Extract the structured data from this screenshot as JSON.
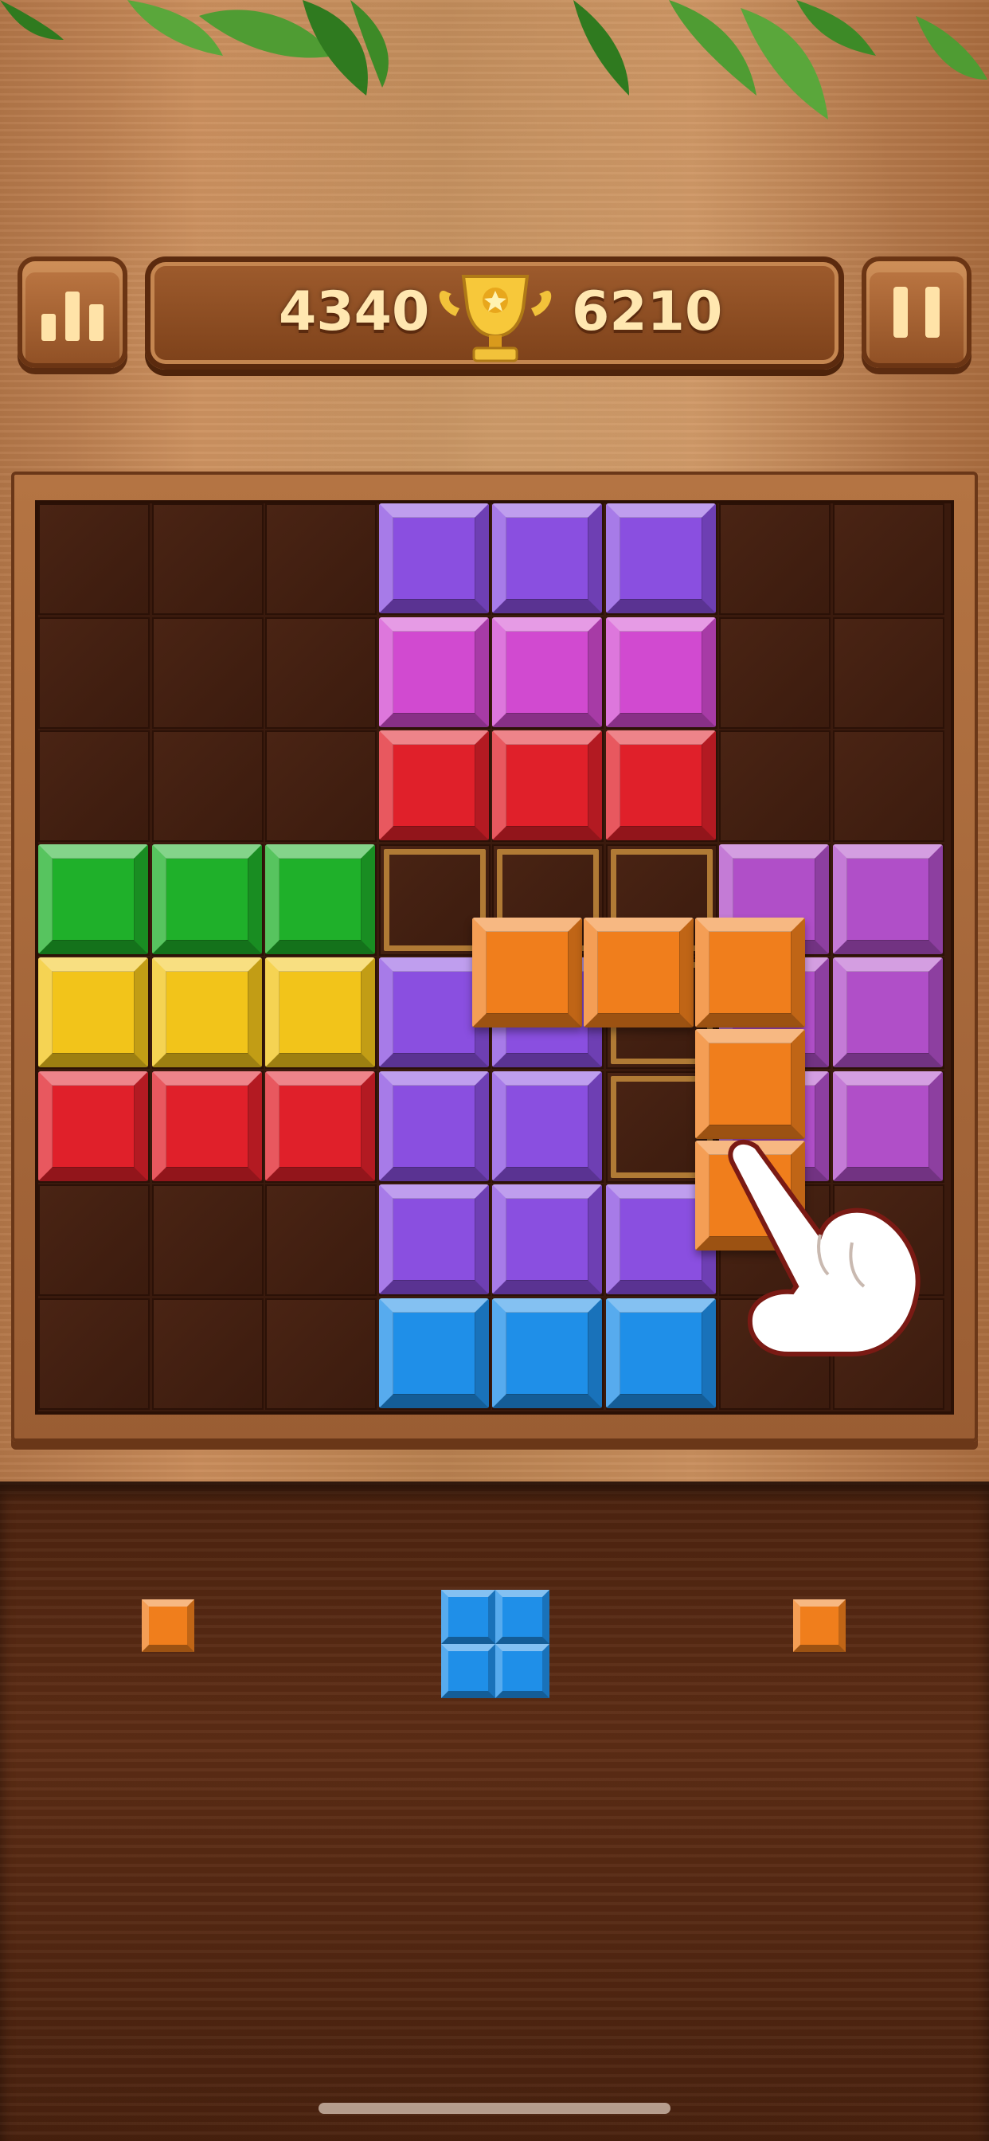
{
  "hud": {
    "current_score": "4340",
    "best_score": "6210",
    "stats_button_icon": "bar-chart-icon",
    "pause_button_icon": "pause-icon",
    "trophy_icon": "trophy-icon"
  },
  "colors": {
    "purple": "#8a4fe0",
    "magenta": "#d14ad0",
    "red": "#e0202a",
    "green": "#1fb02a",
    "yellow": "#f2c41a",
    "blue": "#1f8fe8",
    "orange": "#f07e1c",
    "violet": "#b04fc8"
  },
  "board": {
    "size": 8,
    "grid": [
      [
        null,
        null,
        null,
        "purple",
        "purple",
        "purple",
        null,
        null
      ],
      [
        null,
        null,
        null,
        "magenta",
        "magenta",
        "magenta",
        null,
        null
      ],
      [
        null,
        null,
        null,
        "red",
        "red",
        "red",
        null,
        null
      ],
      [
        "green",
        "green",
        "green",
        "ghost",
        "ghost",
        "ghost",
        "violet",
        "violet"
      ],
      [
        "yellow",
        "yellow",
        "yellow",
        "purple",
        "purple",
        "ghost",
        "violet",
        "violet"
      ],
      [
        "red",
        "red",
        "red",
        "purple",
        "purple",
        "ghost",
        "violet",
        "violet"
      ],
      [
        null,
        null,
        null,
        "purple",
        "purple",
        "purple",
        null,
        null
      ],
      [
        null,
        null,
        null,
        "blue",
        "blue",
        "blue",
        null,
        null
      ]
    ]
  },
  "dragged_piece": {
    "color": "orange",
    "shape": "J-pentomino",
    "icon": "pointing-hand-icon"
  },
  "tray": {
    "pieces": [
      {
        "name": "single-orange-piece",
        "color": "orange",
        "cells": 1
      },
      {
        "name": "square-blue-piece",
        "color": "blue",
        "cells": 4
      },
      {
        "name": "single-orange-piece-2",
        "color": "orange",
        "cells": 1
      }
    ]
  }
}
